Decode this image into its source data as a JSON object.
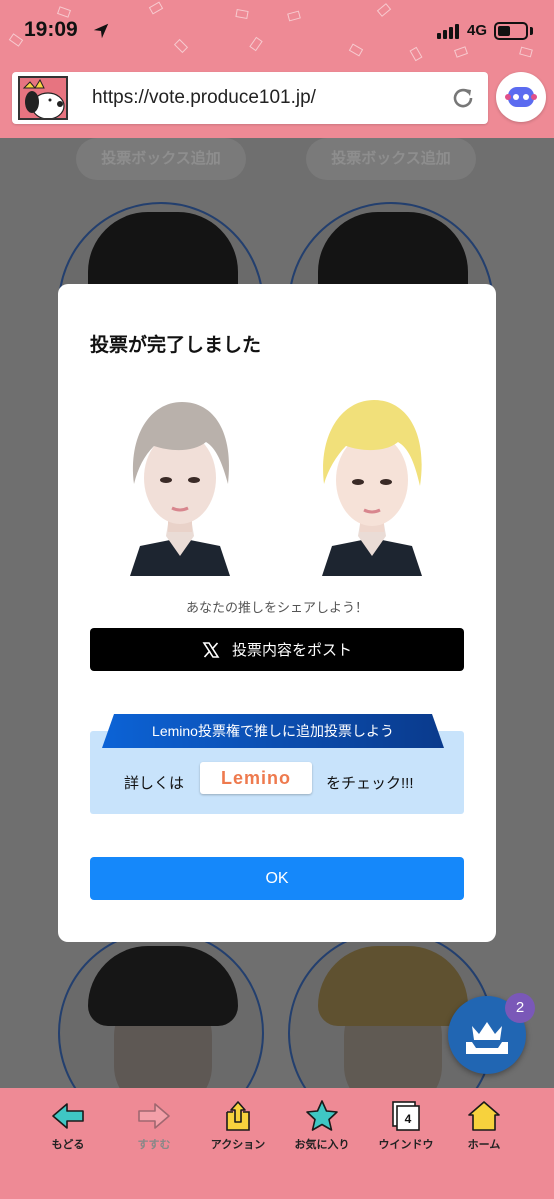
{
  "status_bar": {
    "time": "19:09",
    "network": "4G"
  },
  "browser": {
    "url": "https://vote.produce101.jp/"
  },
  "page": {
    "add_box_left": "投票ボックス追加",
    "add_box_right": "投票ボックス追加",
    "vote_box_count": "2"
  },
  "modal": {
    "title": "投票が完了しました",
    "share_prompt": "あなたの推しをシェアしよう！",
    "post_button": "投票内容をポスト",
    "lemino_banner": "Lemino投票権で推しに追加投票しよう",
    "detail_left": "詳しくは",
    "lemino_logo": "Lemino",
    "detail_right": "をチェック!!!",
    "ok_button": "OK"
  },
  "toolbar": {
    "back": "もどる",
    "forward": "すすむ",
    "action": "アクション",
    "favorites": "お気に入り",
    "window": "ウインドウ",
    "window_count": "4",
    "home": "ホーム"
  },
  "colors": {
    "header_pink": "#ee8a95",
    "ok_blue": "#1588fa",
    "lemino_bg": "#c8e3fb",
    "fab_blue": "#2166b3"
  }
}
